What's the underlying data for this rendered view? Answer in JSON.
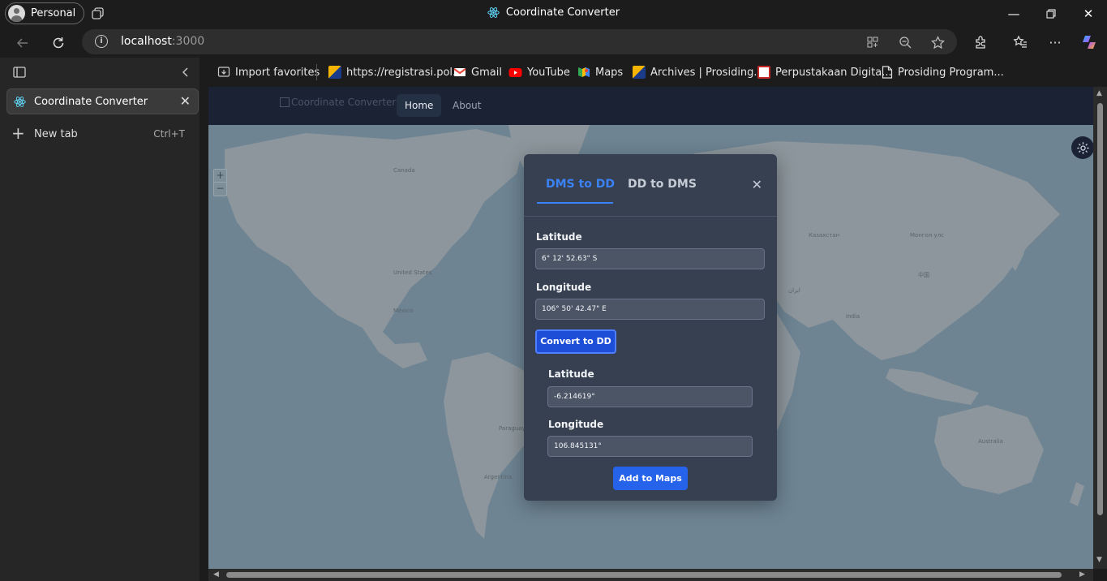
{
  "browser": {
    "profile_label": "Personal",
    "window_title": "Coordinate Converter",
    "url_host": "localhost",
    "url_port": ":3000"
  },
  "sidebar": {
    "tab_title": "Coordinate Converter",
    "new_tab_label": "New tab",
    "new_tab_shortcut": "Ctrl+T"
  },
  "favorites": [
    {
      "label": "Import favorites"
    },
    {
      "label": "https://registrasi.pol..."
    },
    {
      "label": "Gmail"
    },
    {
      "label": "YouTube"
    },
    {
      "label": "Maps"
    },
    {
      "label": "Archives | Prosiding..."
    },
    {
      "label": "Perpustakaan Digita..."
    },
    {
      "label": "Prosiding Program..."
    }
  ],
  "app": {
    "logo_alt": "Coordinate Converter",
    "nav_home": "Home",
    "nav_about": "About",
    "zoom_in": "+",
    "zoom_out": "−"
  },
  "map_labels": {
    "canada": "Canada",
    "united_states": "United States",
    "mexico": "México",
    "kazakhstan": "Казахстан",
    "china": "中国",
    "india": "India",
    "australia": "Australia",
    "argentina": "Argentina",
    "brasil": "Brasil",
    "mongolia": "Монгол улс",
    "iran": "ایران",
    "peru": "Perú",
    "paraguay": "Paraguay",
    "bolivia": "Bolivia"
  },
  "converter": {
    "tab_dms_to_dd": "DMS to DD",
    "tab_dd_to_dms": "DD to DMS",
    "input_lat_label": "Latitude",
    "input_lat_value": "6° 12' 52.63\" S",
    "input_lon_label": "Longitude",
    "input_lon_value": "106° 50' 42.47\" E",
    "convert_button": "Convert to DD",
    "result_lat_label": "Latitude",
    "result_lat_value": "-6.214619°",
    "result_lon_label": "Longitude",
    "result_lon_value": "106.845131°",
    "add_button": "Add to Maps"
  }
}
